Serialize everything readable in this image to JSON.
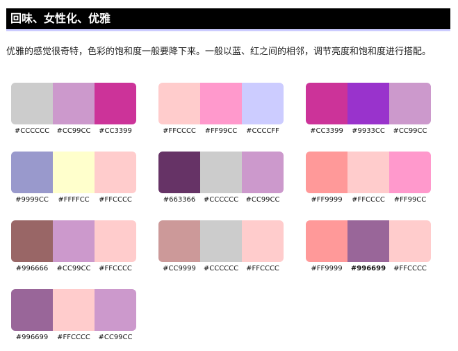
{
  "title": "回味、女性化、优雅",
  "description": "优雅的感觉很奇特，色彩的饱和度一般要降下来。一般以蓝、红之间的相邻，调节亮度和饱和度进行搭配。",
  "palettes": [
    [
      "#CCCCCC",
      "#CC99CC",
      "#CC3399"
    ],
    [
      "#FFCCCC",
      "#FF99CC",
      "#CCCCFF"
    ],
    [
      "#CC3399",
      "#9933CC",
      "#CC99CC"
    ],
    [
      "#9999CC",
      "#FFFFCC",
      "#FFCCCC"
    ],
    [
      "#663366",
      "#CCCCCC",
      "#CC99CC"
    ],
    [
      "#FF9999",
      "#FFCCCC",
      "#FF99CC"
    ],
    [
      "#996666",
      "#CC99CC",
      "#FFCCCC"
    ],
    [
      "#CC9999",
      "#CCCCCC",
      "#FFCCCC"
    ],
    [
      "#FF9999",
      "#996699",
      "#FFCCCC"
    ],
    [
      "#996699",
      "#FFCCCC",
      "#CC99CC"
    ]
  ]
}
